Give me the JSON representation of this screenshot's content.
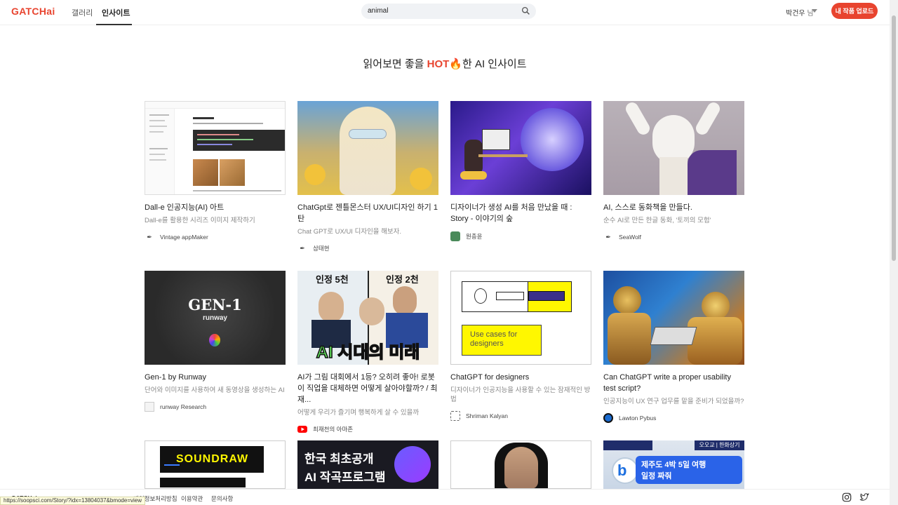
{
  "header": {
    "logo": "GATCHai",
    "nav": [
      "갤러리",
      "인사이트"
    ],
    "search_value": "animal",
    "user_name": "박건우",
    "user_suffix": " 님",
    "upload_label": "내 작품 업로드"
  },
  "section": {
    "title_before": "읽어보면 좋을 ",
    "title_hot": "HOT",
    "title_fire": "🔥",
    "title_after": "한 AI 인사이트"
  },
  "cards": [
    {
      "title": "Dall-e 인공지능(AI) 아트",
      "desc": "Dall-e를 활용한 시리즈 이미지 제작하기",
      "author": "Vintage appMaker"
    },
    {
      "title": "ChatGpt로 젠틀몬스터 UX/UI디자인 하기 1탄",
      "desc": "Chat GPT로 UX/UI 디자인을 해보자.",
      "author": "삼태현"
    },
    {
      "title": "디자이너가 생성 AI를 처음 만났을 때 : Story - 이야기의 숲",
      "desc": "",
      "author": "원충윤"
    },
    {
      "title": "AI, 스스로 동화책을 만들다.",
      "desc": "순수 AI로 만든 한글 동화, '토끼의 모험'",
      "author": "SeaWolf"
    },
    {
      "title": "Gen-1 by Runway",
      "desc": "단어와 이미지를 사용하여 새 동영상을 생성하는 AI",
      "author": "runway Research"
    },
    {
      "title": "AI가 그림 대회에서 1등? 오히려 좋아! 로봇이 직업을 대체하면 어떻게 살아야할까? / 최재...",
      "desc": "어떻게 우리가 즐기며 행복하게 살 수 있을까",
      "author": "최재천의 아마존"
    },
    {
      "title": "ChatGPT for designers",
      "desc": "디자이너가 인공지능을 사용할 수 있는 잠재적인 방법",
      "author": "Shriman Kalyan"
    },
    {
      "title": "Can ChatGPT write a proper usability test script?",
      "desc": "인공지능이 UX 연구 업무를 맡을 준비가 되었을까?",
      "author": "Lawton Pybus"
    }
  ],
  "thumb_text": {
    "gen1": "GEN-1",
    "runway": "runway",
    "interview_left": "인정 5천",
    "interview_right": "인정 2천",
    "interview_caption": "AI 시대의 미래",
    "designers_tag": "Use cases for designers",
    "soundraw": "SOUNDRAW",
    "korea_line1": "한국 최초공개",
    "korea_line2": "AI 작곡프로그램",
    "jeju_badge": "오오교 | 한화상기",
    "jeju_line1": "제주도 4박 5일 여행",
    "jeju_line2": "일정 짜줘"
  },
  "footer": {
    "logo": "GATCHai",
    "links": [
      "개인정보처리방침",
      "이용약관",
      "문의사항"
    ],
    "status_url": "https://soopsci.com/Story/?idx=13804037&bmode=view"
  },
  "colors": {
    "accent": "#e8442f"
  }
}
